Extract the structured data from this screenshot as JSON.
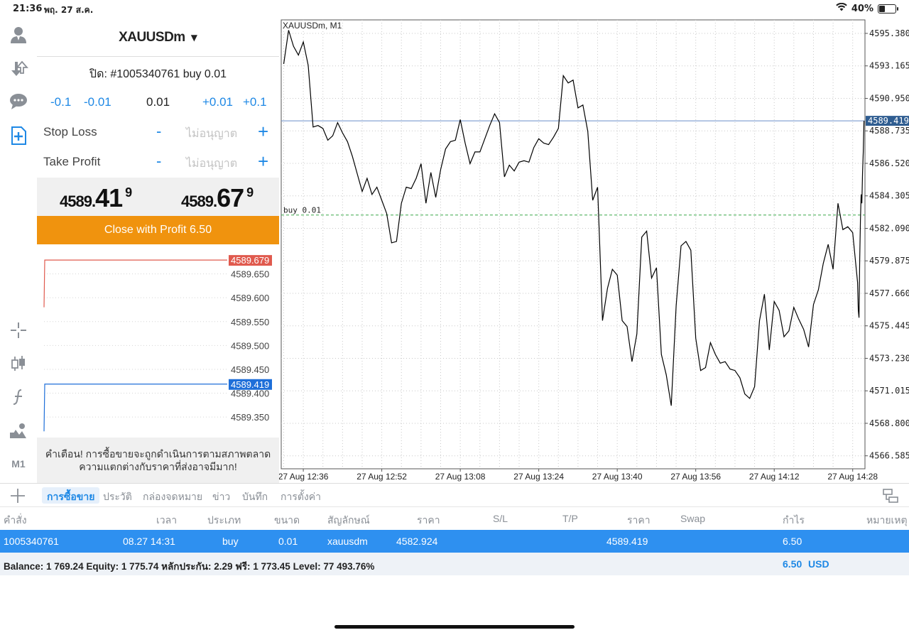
{
  "status_bar": {
    "time": "21:36",
    "date": "พฤ. 27 ส.ค.",
    "battery": "40%",
    "battery_level": 0.4
  },
  "toolbar": {
    "icons": [
      "account-icon",
      "trade-icon",
      "chat-icon",
      "new-order-icon",
      "crosshair-icon",
      "candlestick-icon",
      "indicator-icon",
      "objects-icon"
    ],
    "timeframe_label": "M1"
  },
  "order_panel": {
    "symbol": "XAUUSDm",
    "close_title": "ปิด: #1005340761 buy 0.01",
    "volume": {
      "minus_large": "-0.1",
      "minus_small": "-0.01",
      "value": "0.01",
      "plus_small": "+0.01",
      "plus_large": "+0.1"
    },
    "stop_loss": {
      "label": "Stop Loss",
      "minus": "-",
      "value": "ไม่อนุญาต",
      "plus": "+"
    },
    "take_profit": {
      "label": "Take Profit",
      "minus": "-",
      "value": "ไม่อนุญาต",
      "plus": "+"
    },
    "bid": {
      "base": "4589.",
      "big": "41",
      "sup": "9"
    },
    "ask": {
      "base": "4589.",
      "big": "67",
      "sup": "9"
    },
    "close_button": "Close with Profit 6.50",
    "tick_chart": {
      "y_ticks": [
        4589.65,
        4589.6,
        4589.55,
        4589.5,
        4589.45,
        4589.4,
        4589.35
      ],
      "y_tick_labels": [
        "4589.650",
        "4589.600",
        "4589.550",
        "4589.500",
        "4589.450",
        "4589.400",
        "4589.350"
      ],
      "ask_label": "4589.679",
      "bid_label": "4589.419",
      "ask_value": 4589.679,
      "bid_value": 4589.419,
      "ask_start": 4589.58,
      "bid_start": 4589.32,
      "ask_color": "#e05a4e",
      "bid_color": "#1e6fd9",
      "ylim": [
        4589.31,
        4589.7
      ]
    },
    "warning_line1": "คำเตือน! การซื้อขายจะถูกดำเนินการตามสภาพตลาด",
    "warning_line2": "ความแตกต่างกับราคาที่ส่งอาจมีมาก!"
  },
  "chart_data": {
    "type": "line",
    "title": "XAUUSDm, M1",
    "ylim": [
      4565.7,
      4596.3
    ],
    "y_ticks": [
      4595.38,
      4593.165,
      4590.95,
      4588.735,
      4586.52,
      4584.305,
      4582.09,
      4579.875,
      4577.66,
      4575.445,
      4573.23,
      4571.015,
      4568.8,
      4566.585
    ],
    "y_tick_labels": [
      "4595.380",
      "4593.165",
      "4590.950",
      "4588.735",
      "4586.520",
      "4584.305",
      "4582.090",
      "4579.875",
      "4577.660",
      "4575.445",
      "4573.230",
      "4571.015",
      "4568.800",
      "4566.585"
    ],
    "x_tick_labels": [
      "27 Aug 12:36",
      "27 Aug 12:52",
      "27 Aug 13:08",
      "27 Aug 13:24",
      "27 Aug 13:40",
      "27 Aug 13:56",
      "27 Aug 14:12",
      "27 Aug 14:28"
    ],
    "x_tick_minutes": [
      756,
      772,
      788,
      804,
      820,
      836,
      852,
      868
    ],
    "x_range_minutes": [
      751.5,
      870.5
    ],
    "x": [
      752,
      753,
      754,
      755,
      756,
      757,
      758,
      759,
      760,
      761,
      762,
      763,
      764,
      765,
      766,
      767,
      768,
      769,
      770,
      771,
      772,
      773,
      774,
      775,
      776,
      777,
      778,
      779,
      780,
      781,
      782,
      783,
      784,
      785,
      786,
      787,
      788,
      789,
      790,
      791,
      792,
      793,
      794,
      795,
      796,
      797,
      798,
      799,
      800,
      801,
      802,
      803,
      804,
      805,
      806,
      807,
      808,
      809,
      810,
      811,
      812,
      813,
      814,
      815,
      816,
      817,
      818,
      819,
      820,
      821,
      822,
      823,
      824,
      825,
      826,
      827,
      828,
      829,
      830,
      831,
      832,
      833,
      834,
      835,
      836,
      837,
      838,
      839,
      840,
      841,
      842,
      843,
      844,
      845,
      846,
      847,
      848,
      849,
      850,
      851,
      852,
      853,
      854,
      855,
      856,
      857,
      858,
      859,
      860,
      861,
      862,
      863,
      864,
      865,
      866,
      867,
      868,
      869
    ],
    "series": [
      {
        "values": [
          4593.3,
          4595.6,
          4594.5,
          4593.9,
          4594.8,
          4593.2,
          4589.0,
          4589.1,
          4588.9,
          4588.1,
          4588.4,
          4589.3,
          4588.6,
          4588.0,
          4587.0,
          4585.8,
          4584.6,
          4585.5,
          4584.4,
          4584.9,
          4584.0,
          4583.1,
          4581.1,
          4581.2,
          4583.8,
          4584.9,
          4584.8,
          4585.5,
          4586.5,
          4583.8,
          4585.9,
          4584.2,
          4586.1,
          4587.5,
          4588.0,
          4588.1,
          4589.5,
          4587.9,
          4586.5,
          4587.3,
          4587.3,
          4588.2,
          4589.1,
          4589.9,
          4589.3,
          4585.6,
          4586.4,
          4586.0,
          4586.6,
          4586.7,
          4586.6,
          4587.6,
          4588.2,
          4587.9,
          4587.8,
          4588.3,
          4588.9,
          4592.5,
          4592.0,
          4592.2,
          4590.3,
          4590.5,
          4588.7,
          4584.0,
          4584.9,
          4575.8,
          4578.0,
          4579.3,
          4578.9,
          4575.8,
          4575.4,
          4573.0,
          4574.9,
          4581.5,
          4581.9,
          4578.7,
          4579.4,
          4573.5,
          4572.1,
          4570.0,
          4576.8,
          4580.9,
          4581.2,
          4580.6,
          4574.6,
          4572.4,
          4572.6,
          4574.3,
          4573.5,
          4572.9,
          4573.0,
          4572.5,
          4572.4,
          4571.9,
          4570.8,
          4570.5,
          4571.3,
          4575.8,
          4577.6,
          4573.8,
          4577.1,
          4576.5,
          4574.7,
          4575.1,
          4576.7,
          4575.9,
          4575.2,
          4574.0,
          4576.9,
          4577.9,
          4579.7,
          4581.0,
          4579.3,
          4583.8,
          4582.0,
          4582.2,
          4581.8,
          4578.4,
          4575.6
        ]
      }
    ],
    "tail": [
      4576.5,
      4576.0,
      4580.0,
      4582.6,
      4584.4,
      4583.8,
      4585.9,
      4587.3,
      4589.419
    ],
    "current_price": 4589.419,
    "current_price_label": "4589.419",
    "order_line": {
      "price": 4583.0,
      "label": "buy 0.01",
      "color": "#3aa84a"
    },
    "price_line_color": "#6a8fc9",
    "grid": true
  },
  "bottom_tabs": [
    "การซื้อขาย",
    "ประวัติ",
    "กล่องจดหมาย",
    "ข่าว",
    "บันทึก",
    "การตั้งค่า"
  ],
  "table": {
    "headers": [
      "คำสั่ง",
      "เวลา",
      "ประเภท",
      "ขนาด",
      "สัญลักษณ์",
      "ราคา",
      "S/L",
      "T/P",
      "ราคา",
      "Swap",
      "กำไร",
      "หมายเหตุ"
    ],
    "position": {
      "order": "1005340761",
      "time": "08.27 14:31",
      "type": "buy",
      "size": "0.01",
      "symbol": "xauusdm",
      "open_price": "4582.924",
      "price": "4589.419",
      "profit": "6.50"
    },
    "summary": {
      "text": "Balance: 1 769.24 Equity: 1 775.74 หลักประกัน: 2.29 ฟรี: 1 773.45 Level: 77 493.76%",
      "profit": "6.50",
      "currency": "USD"
    }
  }
}
